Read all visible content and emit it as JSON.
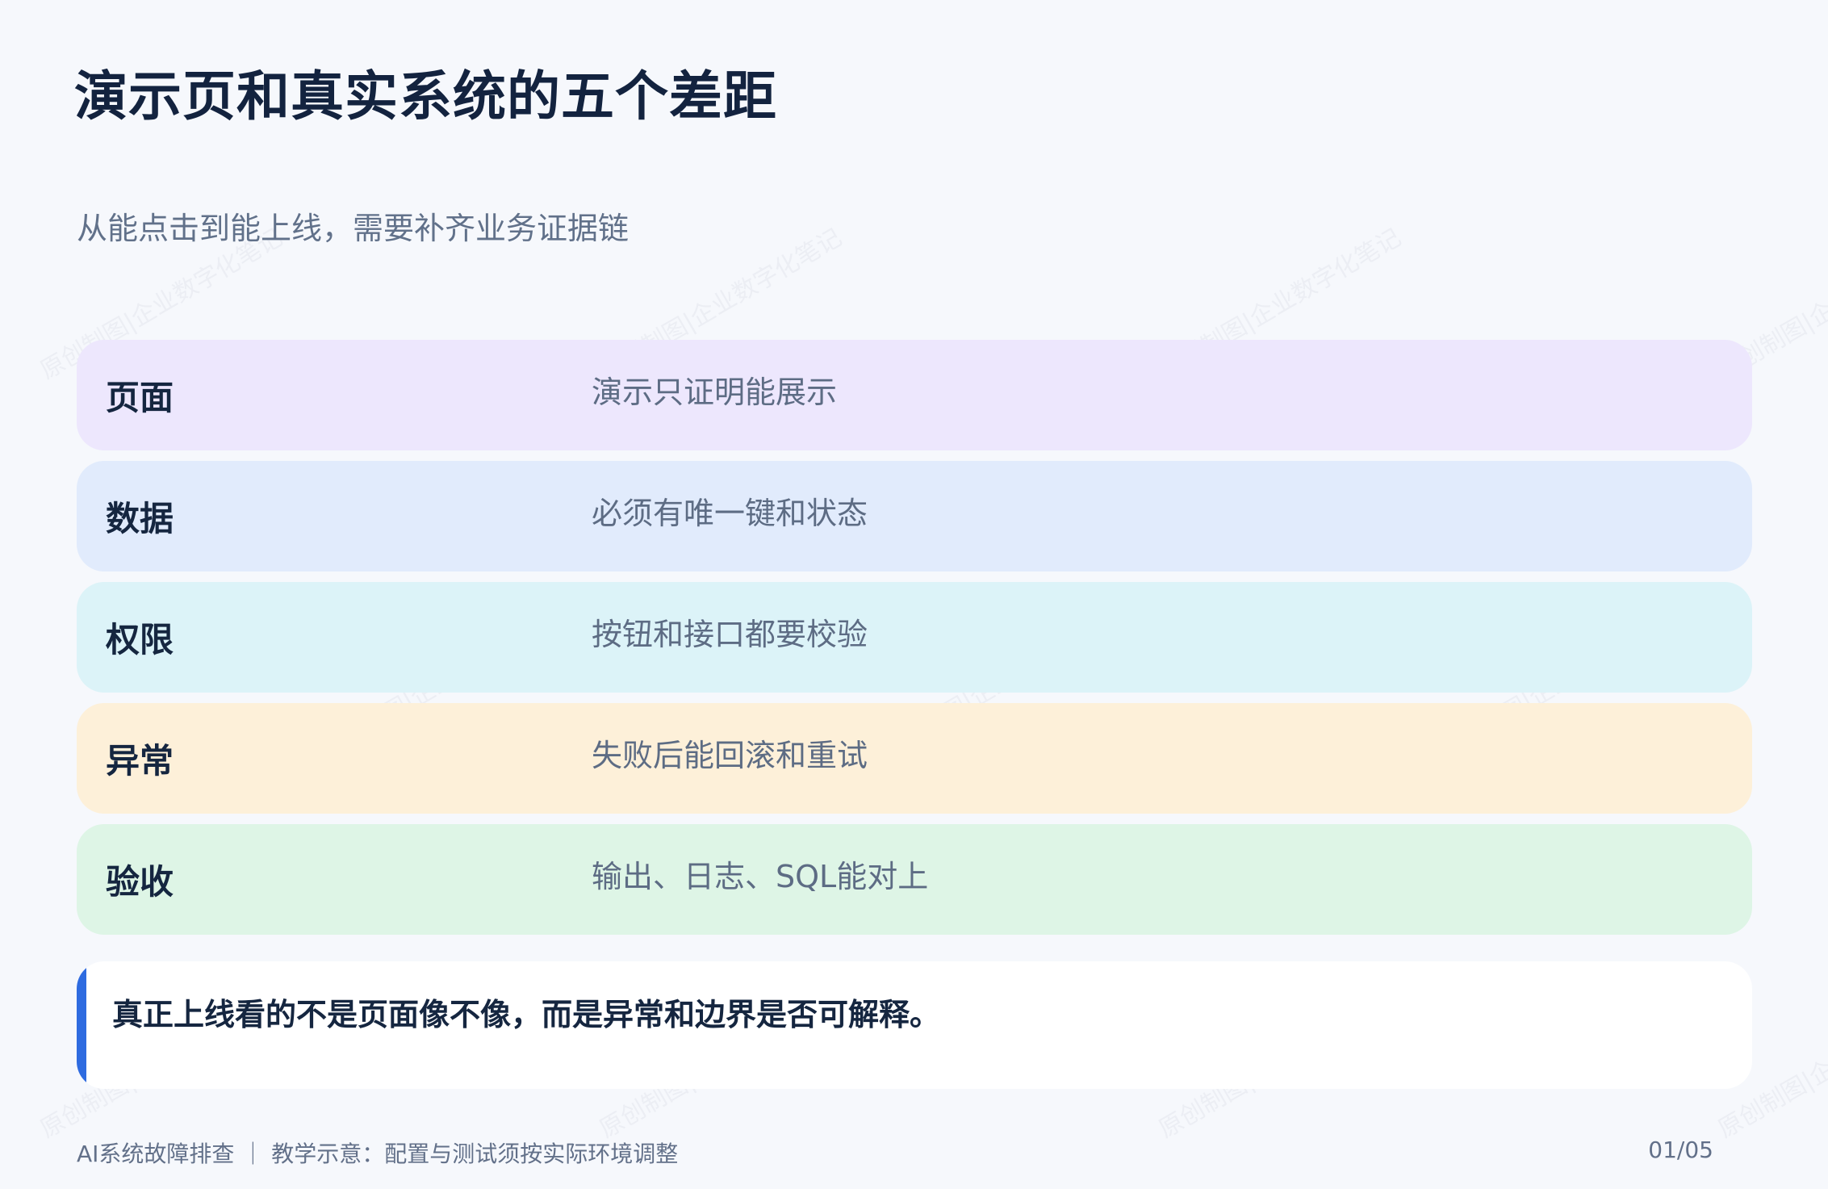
{
  "title": "演示页和真实系统的五个差距",
  "subtitle": "从能点击到能上线，需要补齐业务证据链",
  "watermark": "原创制图|企业数字化笔记",
  "rows": [
    {
      "label": "页面",
      "value": "演示只证明能展示",
      "color": "#ede7fd"
    },
    {
      "label": "数据",
      "value": "必须有唯一键和状态",
      "color": "#e1ebfc"
    },
    {
      "label": "权限",
      "value": "按钮和接口都要校验",
      "color": "#dcf3f8"
    },
    {
      "label": "异常",
      "value": "失败后能回滚和重试",
      "color": "#fdf0d9"
    },
    {
      "label": "验收",
      "value": "输出、日志、SQL能对上",
      "color": "#def5e6"
    }
  ],
  "callout": {
    "text": "真正上线看的不是页面像不像，而是异常和边界是否可解释。",
    "accent_color": "#2e6be0"
  },
  "footer": {
    "left": "AI系统故障排查 ｜ 教学示意：配置与测试须按实际环境调整",
    "page": "01/05"
  }
}
